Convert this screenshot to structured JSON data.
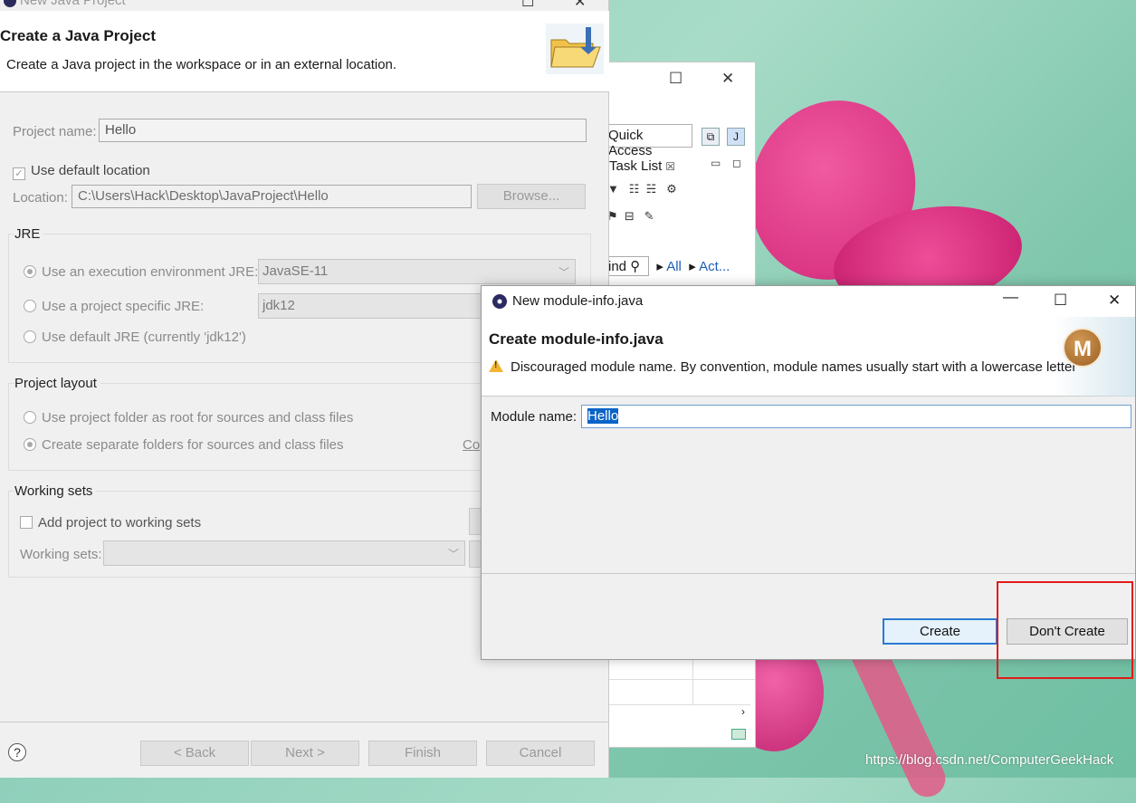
{
  "java_dialog": {
    "window_title": "New Java Project",
    "header_title": "Create a Java Project",
    "header_desc": "Create a Java project in the workspace or in an external location.",
    "project_name_label": "Project name:",
    "project_name_value": "Hello",
    "use_default_location": "Use default location",
    "location_label": "Location:",
    "location_value": "C:\\Users\\Hack\\Desktop\\JavaProject\\Hello",
    "browse_button": "Browse...",
    "jre_group": "JRE",
    "jre_option_env": "Use an execution environment JRE:",
    "jre_env_value": "JavaSE-11",
    "jre_option_specific": "Use a project specific JRE:",
    "jre_specific_value": "jdk12",
    "jre_option_default": "Use default JRE (currently 'jdk12')",
    "layout_group": "Project layout",
    "layout_option_root": "Use project folder as root for sources and class files",
    "layout_option_separate": "Create separate folders for sources and class files",
    "layout_link_partial": "Co",
    "working_sets_group": "Working sets",
    "add_working_sets": "Add project to working sets",
    "working_sets_label": "Working sets:",
    "buttons": {
      "back": "< Back",
      "next": "Next >",
      "finish": "Finish",
      "cancel": "Cancel"
    },
    "help_icon_text": "?"
  },
  "background_window": {
    "quick_access": "Quick Access",
    "task_list": "Task List",
    "find_label": "ind",
    "all_link": "All",
    "act_link": "Act..."
  },
  "module_dialog": {
    "window_title": "New module-info.java",
    "header_title": "Create module-info.java",
    "warning_text": "Discouraged module name. By convention, module names usually start with a lowercase letter",
    "badge_letter": "M",
    "module_name_label": "Module name:",
    "module_name_value": "Hello",
    "create_button": "Create",
    "dont_create_button": "Don't Create"
  },
  "watermark": "https://blog.csdn.net/ComputerGeekHack",
  "colors": {
    "highlight_box": "#e21a1a",
    "accent": "#2a7bd3",
    "warning": "#f2b531"
  }
}
